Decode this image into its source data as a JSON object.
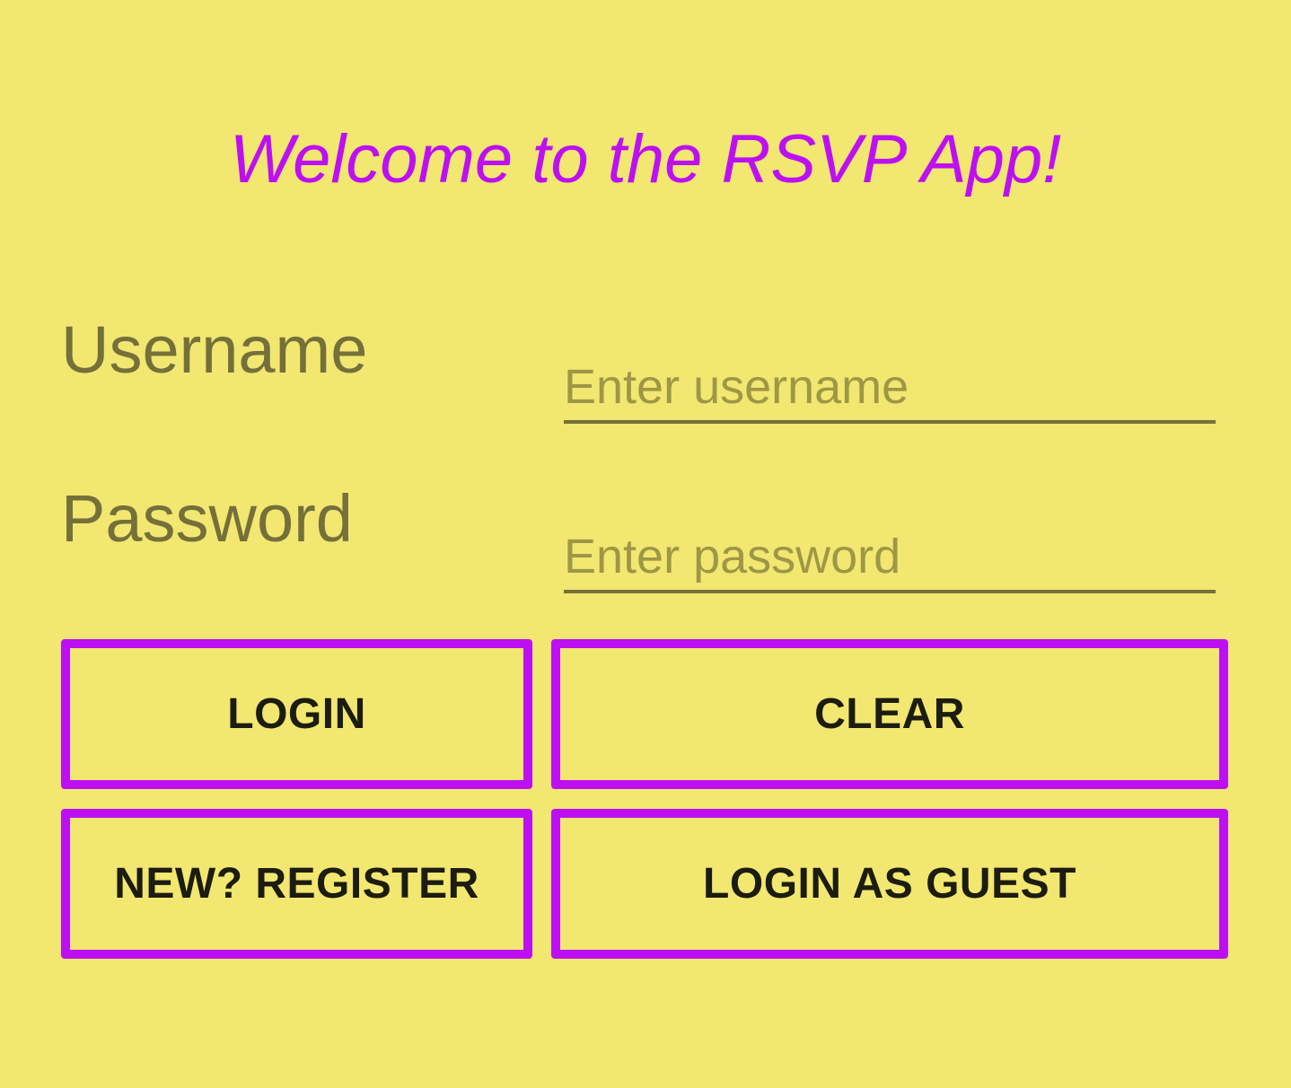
{
  "app": {
    "welcome_title": "Welcome to the RSVP App!"
  },
  "form": {
    "username_label": "Username",
    "username_placeholder": "Enter username",
    "username_value": "",
    "password_label": "Password",
    "password_placeholder": "Enter password",
    "password_value": ""
  },
  "buttons": {
    "login": "LOGIN",
    "clear": "CLEAR",
    "register": "NEW? REGISTER",
    "guest": "LOGIN AS GUEST"
  },
  "colors": {
    "background": "#f2e770",
    "accent": "#bd10f2",
    "label_text": "#75703a",
    "button_text": "#1c1c10"
  }
}
